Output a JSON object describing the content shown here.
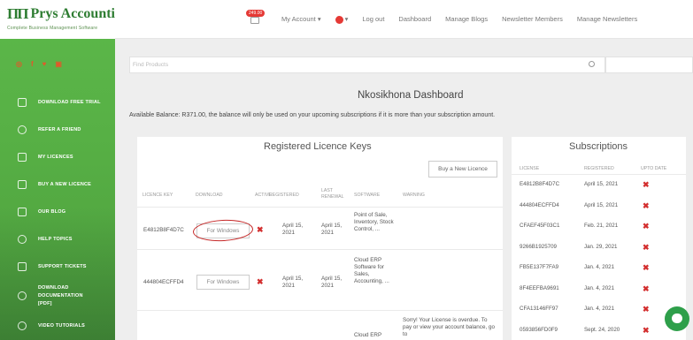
{
  "brand": {
    "name": "Prys Accounting",
    "tagline": "Complete Business Management Software",
    "mark": "ΠΠ"
  },
  "social": [
    {
      "icon": "instagram-icon",
      "glyph": "◎"
    },
    {
      "icon": "facebook-icon",
      "glyph": "f"
    },
    {
      "icon": "twitter-icon",
      "glyph": "♥"
    },
    {
      "icon": "youtube-icon",
      "glyph": "▣"
    }
  ],
  "sidebar": {
    "items": [
      {
        "label": "DOWNLOAD FREE TRIAL",
        "icon": "download-icon"
      },
      {
        "label": "REFER A FRIEND",
        "icon": "share-icon"
      },
      {
        "label": "MY LICENCES",
        "icon": "folder-icon"
      },
      {
        "label": "BUY A NEW LICENCE",
        "icon": "calculator-icon"
      },
      {
        "label": "OUR BLOG",
        "icon": "tag-icon"
      },
      {
        "label": "HELP TOPICS",
        "icon": "globe-icon"
      },
      {
        "label": "SUPPORT TICKETS",
        "icon": "ticket-icon"
      },
      {
        "label": "DOWNLOAD DOCUMENTATION [PDF]",
        "icon": "download-circle-icon"
      },
      {
        "label": "VIDEO TUTORIALS",
        "icon": "help-icon"
      }
    ]
  },
  "topbar": {
    "cart_badge": "249.00",
    "my_account": "My Account ▾",
    "user_menu": "▾",
    "logout": "Log out",
    "dashboard": "Dashboard",
    "manage_blogs": "Manage Blogs",
    "newsletter_members": "Newsletter Members",
    "manage_newsletters": "Manage Newsletters"
  },
  "search": {
    "placeholder": "Find Products"
  },
  "main": {
    "title": "Nkosikhona Dashboard",
    "balance": "Available Balance: R371.00, the balance will only be used on your upcoming subscriptions if it is more than your subscription amount."
  },
  "licences": {
    "title": "Registered Licence Keys",
    "buy_button": "Buy a New Licence",
    "headers": [
      "LICENCE KEY",
      "DOWNLOAD",
      "ACTIVE",
      "REGISTERED",
      "LAST RENEWAL",
      "SOFTWARE",
      "WARNING"
    ],
    "rows": [
      {
        "key": "E4812B8F4D7C",
        "download": "For Windows",
        "active": "✖",
        "registered": "April 15, 2021",
        "renewal": "April 15, 2021",
        "software": "Point of Sale, Inventory, Stock Control, ...",
        "warning": ""
      },
      {
        "key": "444804ECFFD4",
        "download": "For Windows",
        "active": "✖",
        "registered": "April 15, 2021",
        "renewal": "April 15, 2021",
        "software": "Cloud ERP Software for Sales, Accounting, ...",
        "warning": ""
      },
      {
        "key": "",
        "download": "",
        "active": "",
        "registered": "",
        "renewal": "",
        "software": "Cloud ERP",
        "warning": "Sorry! Your License is overdue. To pay or view your account balance, go to"
      }
    ]
  },
  "subscriptions": {
    "title": "Subscriptions",
    "headers": [
      "LICENSE",
      "REGISTERED",
      "UPTO DATE"
    ],
    "rows": [
      {
        "license": "E4812B8F4D7C",
        "registered": "April 15, 2021",
        "uptodate": "✖"
      },
      {
        "license": "444804ECFFD4",
        "registered": "April 15, 2021",
        "uptodate": "✖"
      },
      {
        "license": "CFAEF45F03C1",
        "registered": "Feb. 21, 2021",
        "uptodate": "✖"
      },
      {
        "license": "9266B1925709",
        "registered": "Jan. 29, 2021",
        "uptodate": "✖"
      },
      {
        "license": "FB5E137F7FA9",
        "registered": "Jan. 4, 2021",
        "uptodate": "✖"
      },
      {
        "license": "8F4EEFBA9691",
        "registered": "Jan. 4, 2021",
        "uptodate": "✖"
      },
      {
        "license": "CFA13146FF97",
        "registered": "Jan. 4, 2021",
        "uptodate": "✖"
      },
      {
        "license": "0593856FD0F9",
        "registered": "Sept. 24, 2020",
        "uptodate": "✖"
      }
    ]
  },
  "colors": {
    "sidebar": "#5cb84a",
    "accent": "#e53935",
    "brand": "#2e7d32"
  }
}
